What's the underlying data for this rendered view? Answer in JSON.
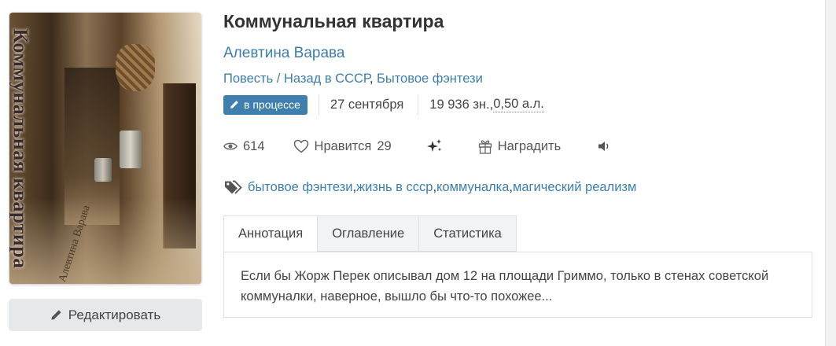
{
  "cover": {
    "title_text": "Коммунальная квартира",
    "author_text": "Алевтина Варава"
  },
  "edit_button": {
    "label": "Редактировать",
    "icon": "pencil-icon"
  },
  "book": {
    "title": "Коммунальная квартира",
    "author": "Алевтина Варава",
    "genre_form": "Повесть",
    "genre_sep": " / ",
    "genre_main": "Назад в СССР",
    "genre_comma": ", ",
    "genre_sub": "Бытовое фэнтези"
  },
  "status": {
    "badge": "в процессе",
    "badge_color": "#3f7fae",
    "date": "27 сентября",
    "size_chars": "19 936 зн., ",
    "size_sheets": "0,50 а.л."
  },
  "stats": {
    "views": "614",
    "like_label": "Нравится",
    "likes": "29",
    "reward_label": "Наградить"
  },
  "tags": {
    "t1": "бытовое фэнтези",
    "t2": "жизнь в ссср",
    "t3": "коммуналка",
    "t4": "магический реализм",
    "comma": ", "
  },
  "tabs": {
    "annotation": "Аннотация",
    "contents": "Оглавление",
    "statistics": "Статистика"
  },
  "annotation_text": "Если бы Жорж Перек описывал дом 12 на площади Гриммо, только в стенах советской коммуналки, наверное, вышло бы что-то похожее...",
  "colors": {
    "link": "#3d7eab",
    "accent": "#3f7fae"
  }
}
